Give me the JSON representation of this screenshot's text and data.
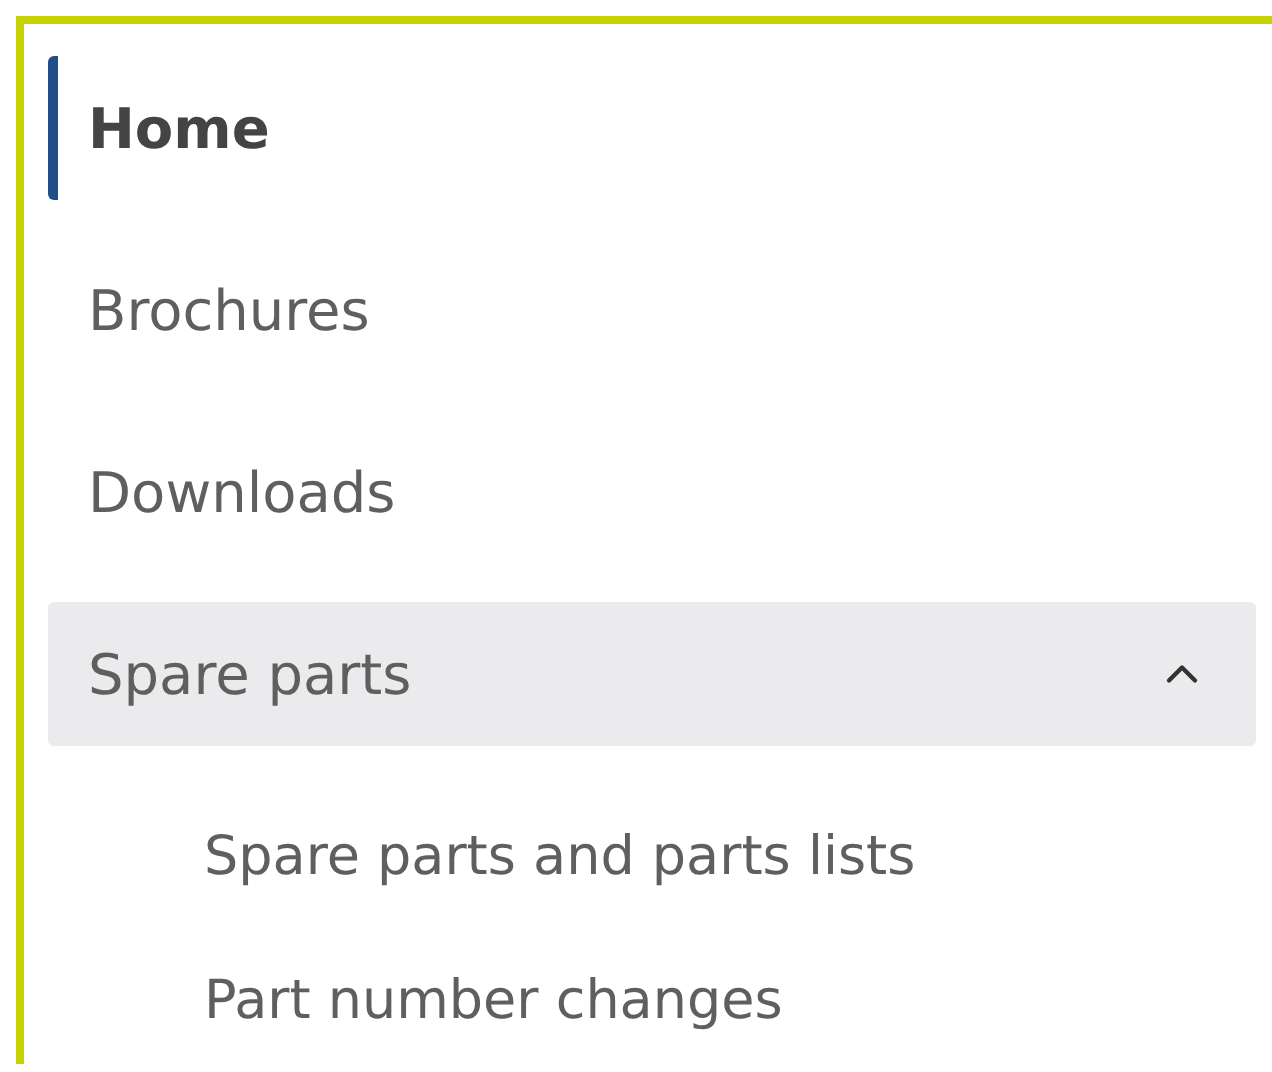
{
  "nav": [
    {
      "label": "Home",
      "selected": true,
      "expanded": false
    },
    {
      "label": "Brochures",
      "selected": false,
      "expanded": false
    },
    {
      "label": "Downloads",
      "selected": false,
      "expanded": false
    },
    {
      "label": "Spare parts",
      "selected": false,
      "expanded": true,
      "children": [
        {
          "label": "Spare parts and parts lists",
          "selected": false
        },
        {
          "label": "Part number changes",
          "selected": false
        }
      ]
    }
  ]
}
